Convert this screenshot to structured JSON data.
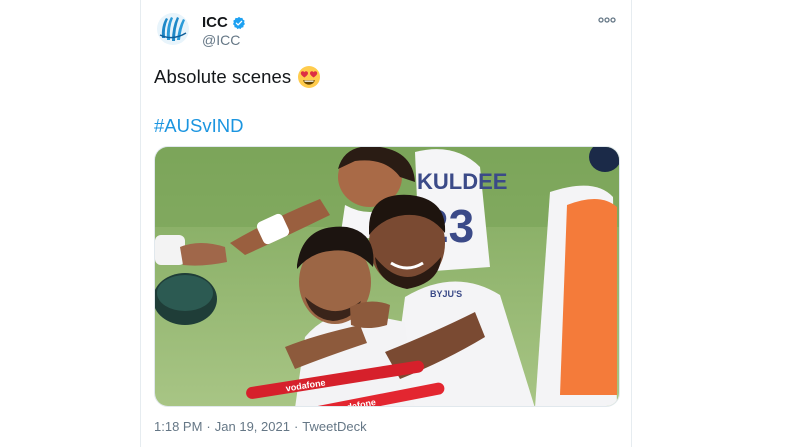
{
  "tweet": {
    "display_name": "ICC",
    "handle": "@ICC",
    "text": "Absolute scenes",
    "emoji": "😍",
    "hashtag": "#AUSvIND",
    "time": "1:18 PM",
    "separator": "·",
    "date": "Jan 19, 2021",
    "source": "TweetDeck"
  },
  "photo": {
    "jersey_text": "KULDEE",
    "jersey_number": "23",
    "sponsor_text": "BYJU'S",
    "stump_text_1": "vodafone",
    "stump_text_2": "vodafone"
  },
  "colors": {
    "hashtag": "#1b95e0",
    "verified": "#1da1f2",
    "grass": "#8fb36a",
    "orange_bib": "#f47b3a"
  },
  "icons": [
    "icc-logo-icon",
    "verified-badge-icon",
    "more-options-icon",
    "heart-eyes-emoji-icon"
  ]
}
